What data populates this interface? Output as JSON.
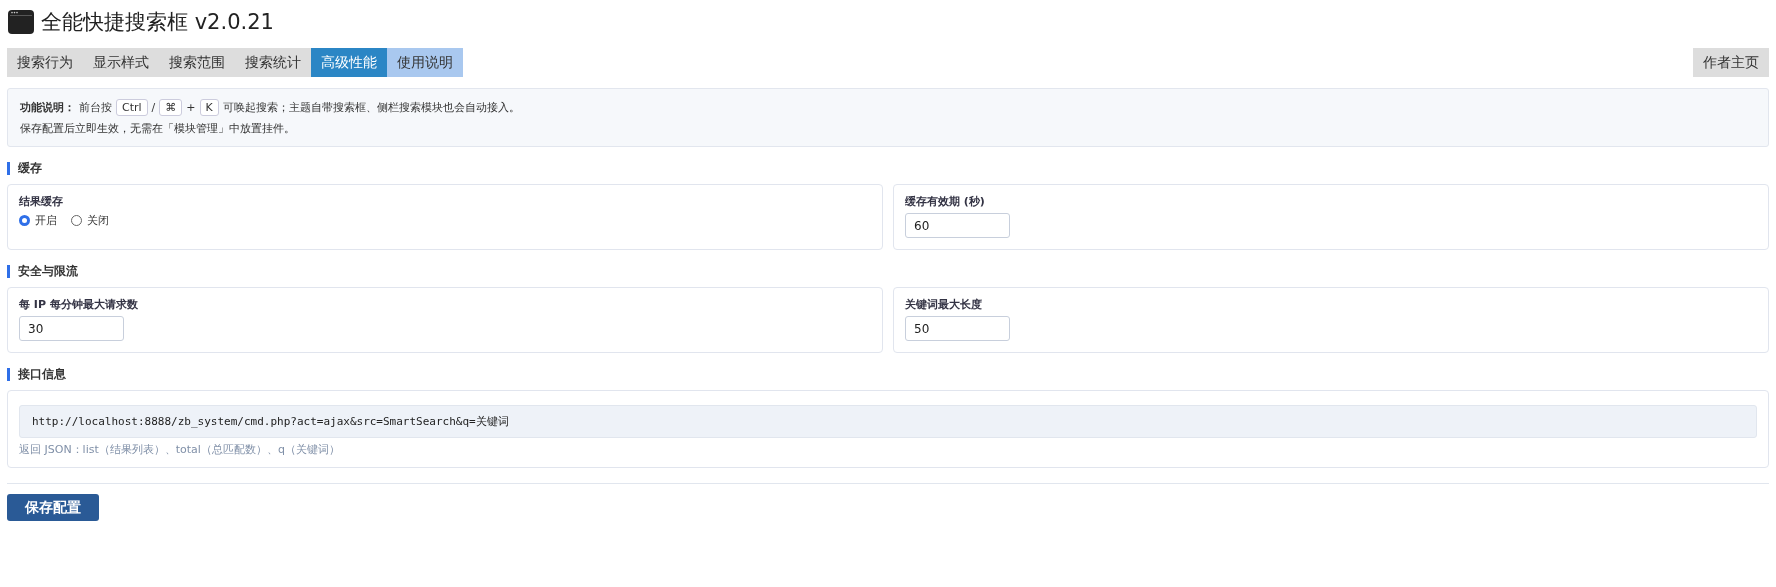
{
  "window": {
    "title": "全能快捷搜索框 v2.0.21"
  },
  "tabs": [
    {
      "label": "搜索行为",
      "selected": false,
      "kind": "plain"
    },
    {
      "label": "显示样式",
      "selected": false,
      "kind": "plain"
    },
    {
      "label": "搜索范围",
      "selected": false,
      "kind": "plain"
    },
    {
      "label": "搜索统计",
      "selected": false,
      "kind": "plain"
    },
    {
      "label": "高级性能",
      "selected": true,
      "kind": "plain"
    },
    {
      "label": "使用说明",
      "selected": false,
      "kind": "help"
    }
  ],
  "author_link": "作者主页",
  "notice": {
    "label": "功能说明：",
    "parts": [
      {
        "kind": "text",
        "text": "前台按"
      },
      {
        "kind": "key",
        "text": "Ctrl"
      },
      {
        "kind": "text",
        "text": "/"
      },
      {
        "kind": "key",
        "text": "⌘"
      },
      {
        "kind": "text",
        "text": "+"
      },
      {
        "kind": "key",
        "text": "K"
      },
      {
        "kind": "text",
        "text": "可唤起搜索；主题自带搜索框、侧栏搜索模块也会自动接入。"
      }
    ],
    "line2": "保存配置后立即生效，无需在「模块管理」中放置挂件。"
  },
  "sections": [
    {
      "title": "缓存",
      "kind": "fields",
      "fields": [
        {
          "kind": "radio",
          "label": "结果缓存",
          "options": [
            {
              "label": "开启",
              "selected": true
            },
            {
              "label": "关闭",
              "selected": false
            }
          ]
        },
        {
          "kind": "input",
          "label": "缓存有效期 (秒)",
          "value": "60"
        }
      ]
    },
    {
      "title": "安全与限流",
      "kind": "fields",
      "fields": [
        {
          "kind": "input",
          "label": "每 IP 每分钟最大请求数",
          "value": "30"
        },
        {
          "kind": "input",
          "label": "关键词最大长度",
          "value": "50"
        }
      ]
    },
    {
      "title": "接口信息",
      "kind": "api",
      "url": "http://localhost:8888/zb_system/cmd.php?act=ajax&src=SmartSearch&q=关键词",
      "note": "返回 JSON：list（结果列表）、total（总匹配数）、q（关键词）"
    }
  ],
  "save_button": "保存配置"
}
